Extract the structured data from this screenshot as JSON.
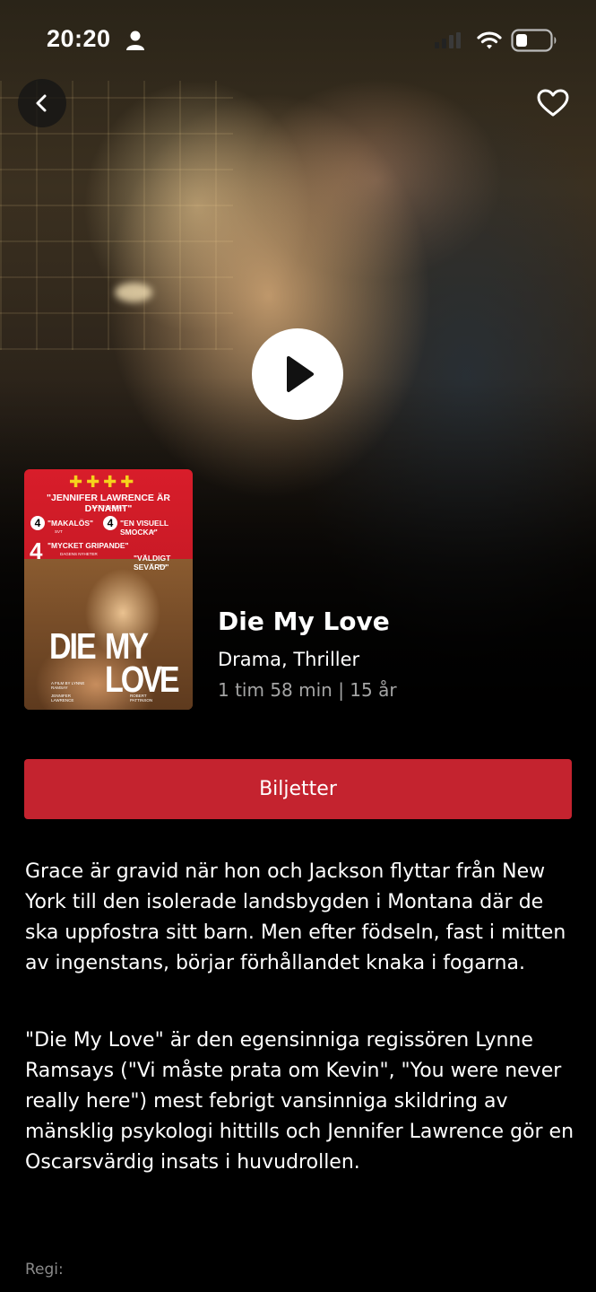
{
  "status_bar": {
    "time": "20:20",
    "icons": [
      "person-icon",
      "signal-icon",
      "wifi-icon",
      "battery-icon"
    ]
  },
  "header": {
    "back_icon": "chevron-left-icon",
    "favorite_icon": "heart-icon"
  },
  "hero": {
    "play_icon": "play-icon"
  },
  "poster": {
    "quote_main": "\"JENNIFER LAWRENCE ÄR DYNAMIT\"",
    "quote_main_source": "AFTONBLADET",
    "rating_1": "4",
    "quote_1": "\"MAKALÖS\"",
    "quote_1_source": "SVT",
    "rating_2": "4",
    "quote_2": "\"EN VISUELL SMOCKA\"",
    "quote_2_source": "GP",
    "rating_3": "4",
    "quote_3": "\"MYCKET GRIPANDE\"",
    "quote_3_source": "DAGENS NYHETER",
    "quote_4": "\"VÄLDIGT SEVÄRD\"",
    "quote_4_source": "TT4",
    "title_line_1a": "DIE",
    "title_line_1b": "MY",
    "title_line_2": "LOVE",
    "credit_director": "A FILM BY LYNNE RAMSAY",
    "credit_actor_1": "JENNIFER LAWRENCE",
    "credit_actor_2": "ROBERT PATTINSON"
  },
  "movie": {
    "title": "Die My Love",
    "genres": "Drama, Thriller",
    "meta": "1 tim 58 min | 15 år"
  },
  "tickets_button": "Biljetter",
  "description": [
    "Grace är gravid när hon och Jackson flyttar från New York till den isolerade landsbygden i Montana där de ska uppfostra sitt barn. Men efter födseln, fast i mitten av ingenstans, börjar förhållandet knaka i fogarna.",
    "\"Die My Love\" är den egensinniga regissören Lynne Ramsays (\"Vi måste prata om Kevin\", \"You were never really here\") mest febrigt vansinniga skildring av mänsklig psykologi hittills och Jennifer Lawrence gör en Oscarsvärdig insats i huvudrollen."
  ],
  "director_label": "Regi:",
  "colors": {
    "accent_red": "#c4232f",
    "meta_gray": "#a4a4a4",
    "background": "#000000"
  }
}
